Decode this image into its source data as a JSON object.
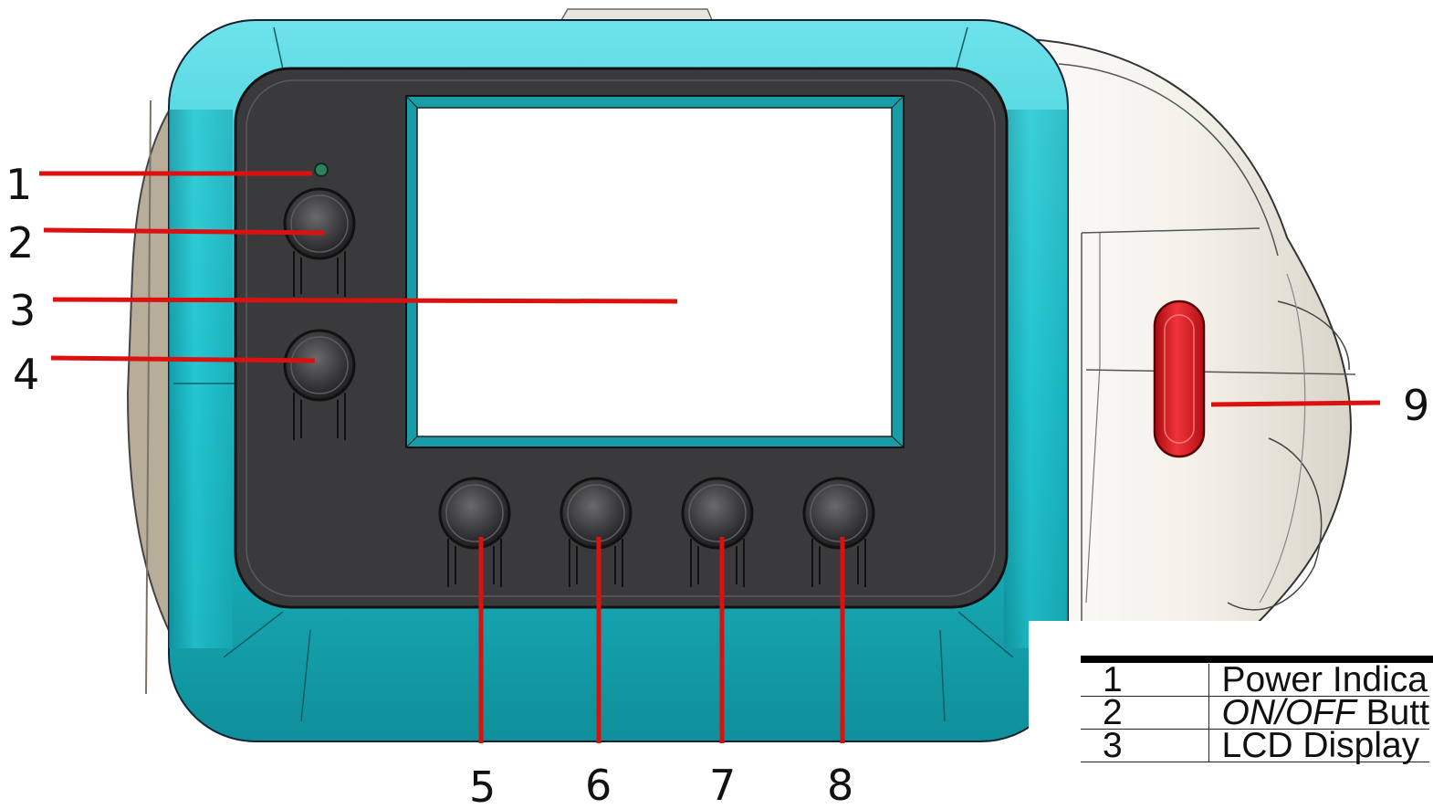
{
  "callouts": [
    {
      "number": "1",
      "target": "power-indicator"
    },
    {
      "number": "2",
      "target": "on-off-button"
    },
    {
      "number": "3",
      "target": "lcd-display"
    },
    {
      "number": "4",
      "target": "left-lower-button"
    },
    {
      "number": "5",
      "target": "bottom-button-1"
    },
    {
      "number": "6",
      "target": "bottom-button-2"
    },
    {
      "number": "7",
      "target": "bottom-button-3"
    },
    {
      "number": "8",
      "target": "bottom-button-4"
    },
    {
      "number": "9",
      "target": "side-trigger"
    }
  ],
  "legend": {
    "rows": [
      {
        "number": "1",
        "prefix": "",
        "text": "Power Indica"
      },
      {
        "number": "2",
        "prefix": "ON/OFF",
        "text": " Butt"
      },
      {
        "number": "3",
        "prefix": "",
        "text": "LCD Display"
      }
    ]
  },
  "colors": {
    "body_teal": "#1fc3cf",
    "face_dark": "#3a3a3c",
    "leader_red": "#dd1010",
    "trigger_red": "#d8141b",
    "shell_white": "#f4f1ea",
    "side_tan": "#b7ad99"
  }
}
